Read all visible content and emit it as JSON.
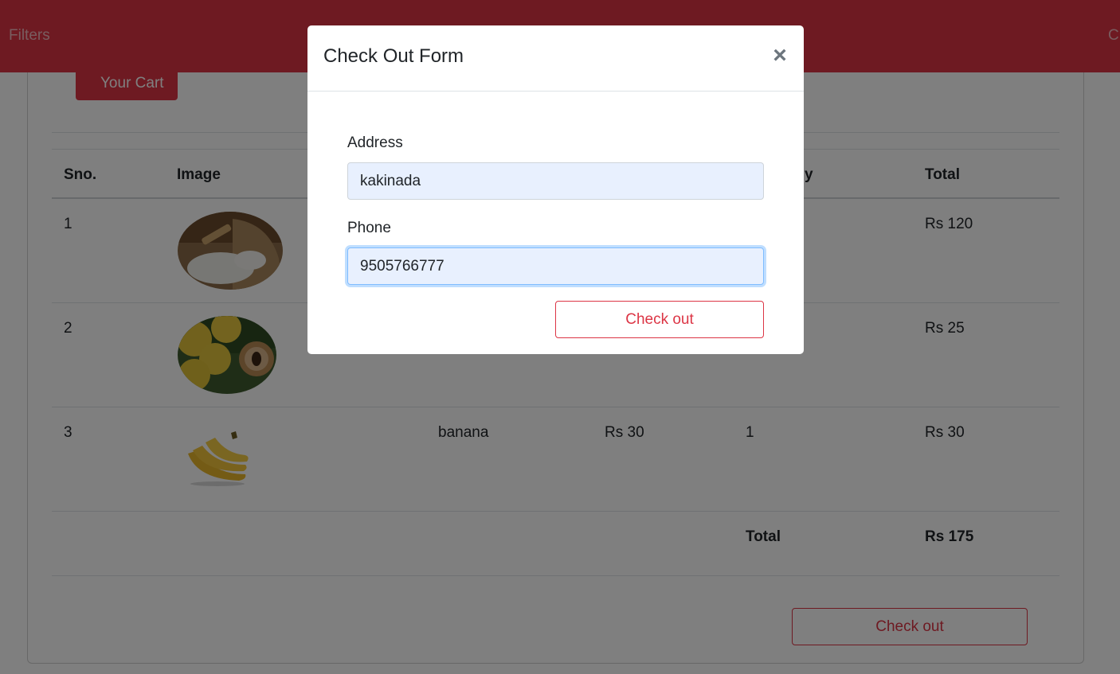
{
  "navbar": {
    "left_link": "Filters",
    "right_link_partial": "C"
  },
  "cart": {
    "title_button": "Your Cart",
    "columns": [
      "Sno.",
      "Image",
      "y",
      "Total"
    ],
    "rows": [
      {
        "sno": "1",
        "image": "rice-image",
        "item": "",
        "price": "",
        "qty": "",
        "total": "Rs 120"
      },
      {
        "sno": "2",
        "image": "sapota-image",
        "item": "",
        "price": "",
        "qty": "",
        "total": "Rs 25"
      },
      {
        "sno": "3",
        "image": "banana-image",
        "item": "banana",
        "price": "Rs 30",
        "qty": "1",
        "total": "Rs 30"
      }
    ],
    "footer": {
      "label": "Total",
      "value": "Rs 175"
    },
    "checkout_label": "Check out"
  },
  "modal": {
    "title": "Check Out Form",
    "close_glyph": "×",
    "address_label": "Address",
    "address_value": "kakinada",
    "phone_label": "Phone",
    "phone_value": "9505766777",
    "submit_label": "Check out"
  },
  "colors": {
    "brand": "#dc3545",
    "input_bg": "#e8f0fe",
    "backdrop": "rgba(0,0,0,0.5)"
  }
}
